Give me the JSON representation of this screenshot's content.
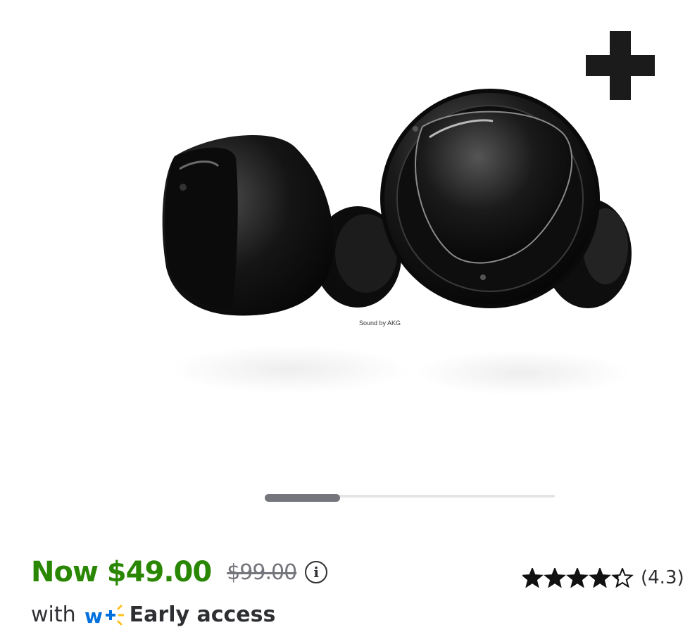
{
  "product": {
    "image_icon": "earbuds-product-image",
    "image_brand_text": "Sound by AKG",
    "badge_icon": "plus-icon"
  },
  "carousel": {
    "progress": 0.26
  },
  "price": {
    "now": "Now $49.00",
    "was": "$99.00",
    "info_glyph": "i",
    "now_color": "#2a8703",
    "was_color": "#74767c"
  },
  "rating": {
    "value": 4.3,
    "stars_max": 5,
    "label": "(4.3)"
  },
  "membership": {
    "prefix": "with",
    "logo_icon": "walmart-plus-icon",
    "label": "Early access",
    "logo_color": "#0071dc",
    "spark_color": "#ffc220"
  }
}
